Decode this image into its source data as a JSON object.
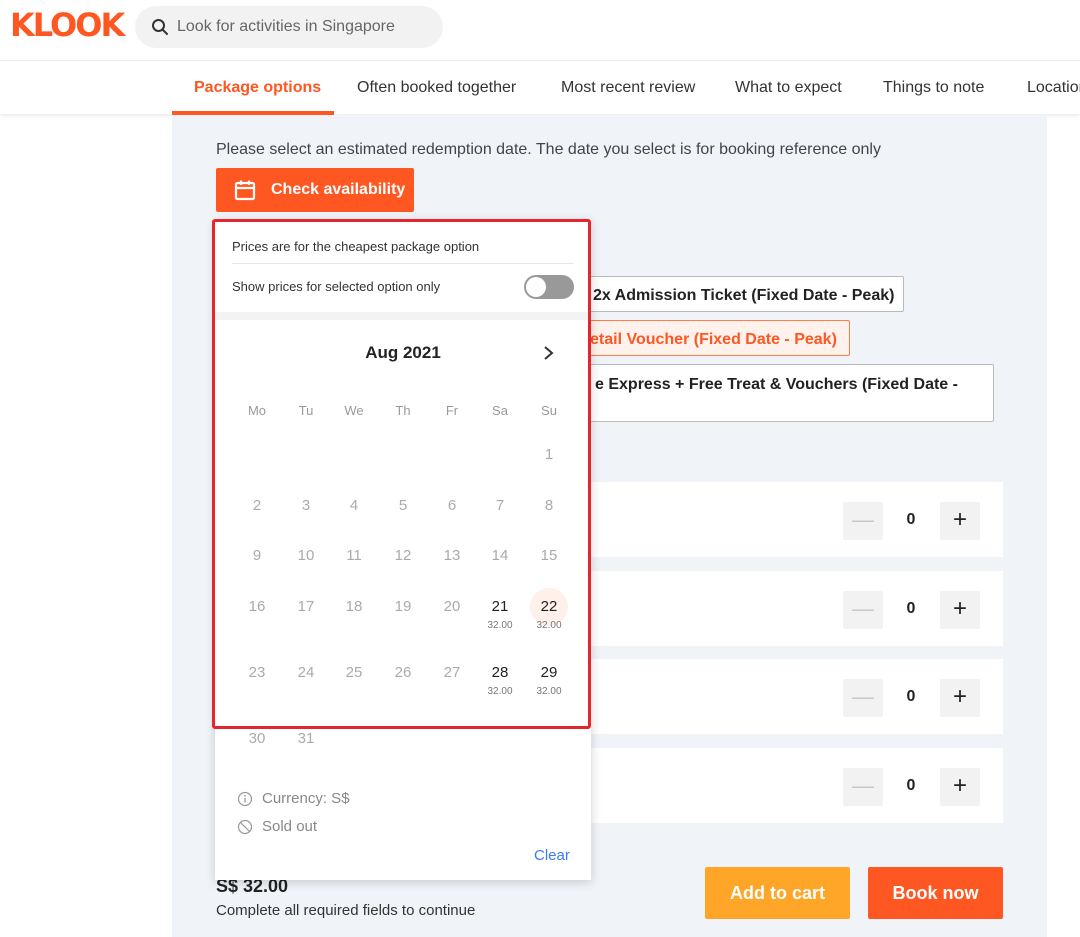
{
  "header": {
    "logo": "KLOOK",
    "search_placeholder": "Look for activities in Singapore"
  },
  "tabs": [
    "Package options",
    "Often booked together",
    "Most recent review",
    "What to expect",
    "Things to note",
    "Location"
  ],
  "booking": {
    "hint": "Please select an estimated redemption date. The date you select is for booking reference only",
    "check_label": "Check availability",
    "options": [
      "2x Admission Ticket (Fixed Date - Peak)",
      "etail Voucher (Fixed Date - Peak)",
      "e Express + Free Treat & Vouchers (Fixed Date -"
    ],
    "quantities": [
      "0",
      "0",
      "0",
      "0"
    ],
    "minus": "—",
    "plus": "+",
    "price": "S$ 32.00",
    "required": "Complete all required fields to continue",
    "add_to_cart": "Add to cart",
    "book_now": "Book now"
  },
  "calendar": {
    "note": "Prices are for the cheapest package option",
    "toggle_label": "Show prices for selected option only",
    "month": "Aug 2021",
    "weekdays": [
      "Mo",
      "Tu",
      "We",
      "Th",
      "Fr",
      "Sa",
      "Su"
    ],
    "weeks": [
      [
        null,
        null,
        null,
        null,
        null,
        null,
        "1"
      ],
      [
        "2",
        "3",
        "4",
        "5",
        "6",
        "7",
        "8"
      ],
      [
        "9",
        "10",
        "11",
        "12",
        "13",
        "14",
        "15"
      ],
      [
        "16",
        "17",
        "18",
        "19",
        "20",
        "21",
        "22"
      ],
      [
        "23",
        "24",
        "25",
        "26",
        "27",
        "28",
        "29"
      ],
      [
        "30",
        "31",
        null,
        null,
        null,
        null,
        null
      ]
    ],
    "prices": {
      "21": "32.00",
      "22": "32.00",
      "28": "32.00",
      "29": "32.00"
    },
    "available": [
      "21",
      "22",
      "28",
      "29"
    ],
    "selected": "22",
    "currency": "Currency: S$",
    "sold_out": "Sold out",
    "clear": "Clear"
  },
  "colors": {
    "brand": "#ff5722",
    "cart": "#ffa628",
    "highlight": "#e5262c",
    "link": "#3a7ee6"
  }
}
